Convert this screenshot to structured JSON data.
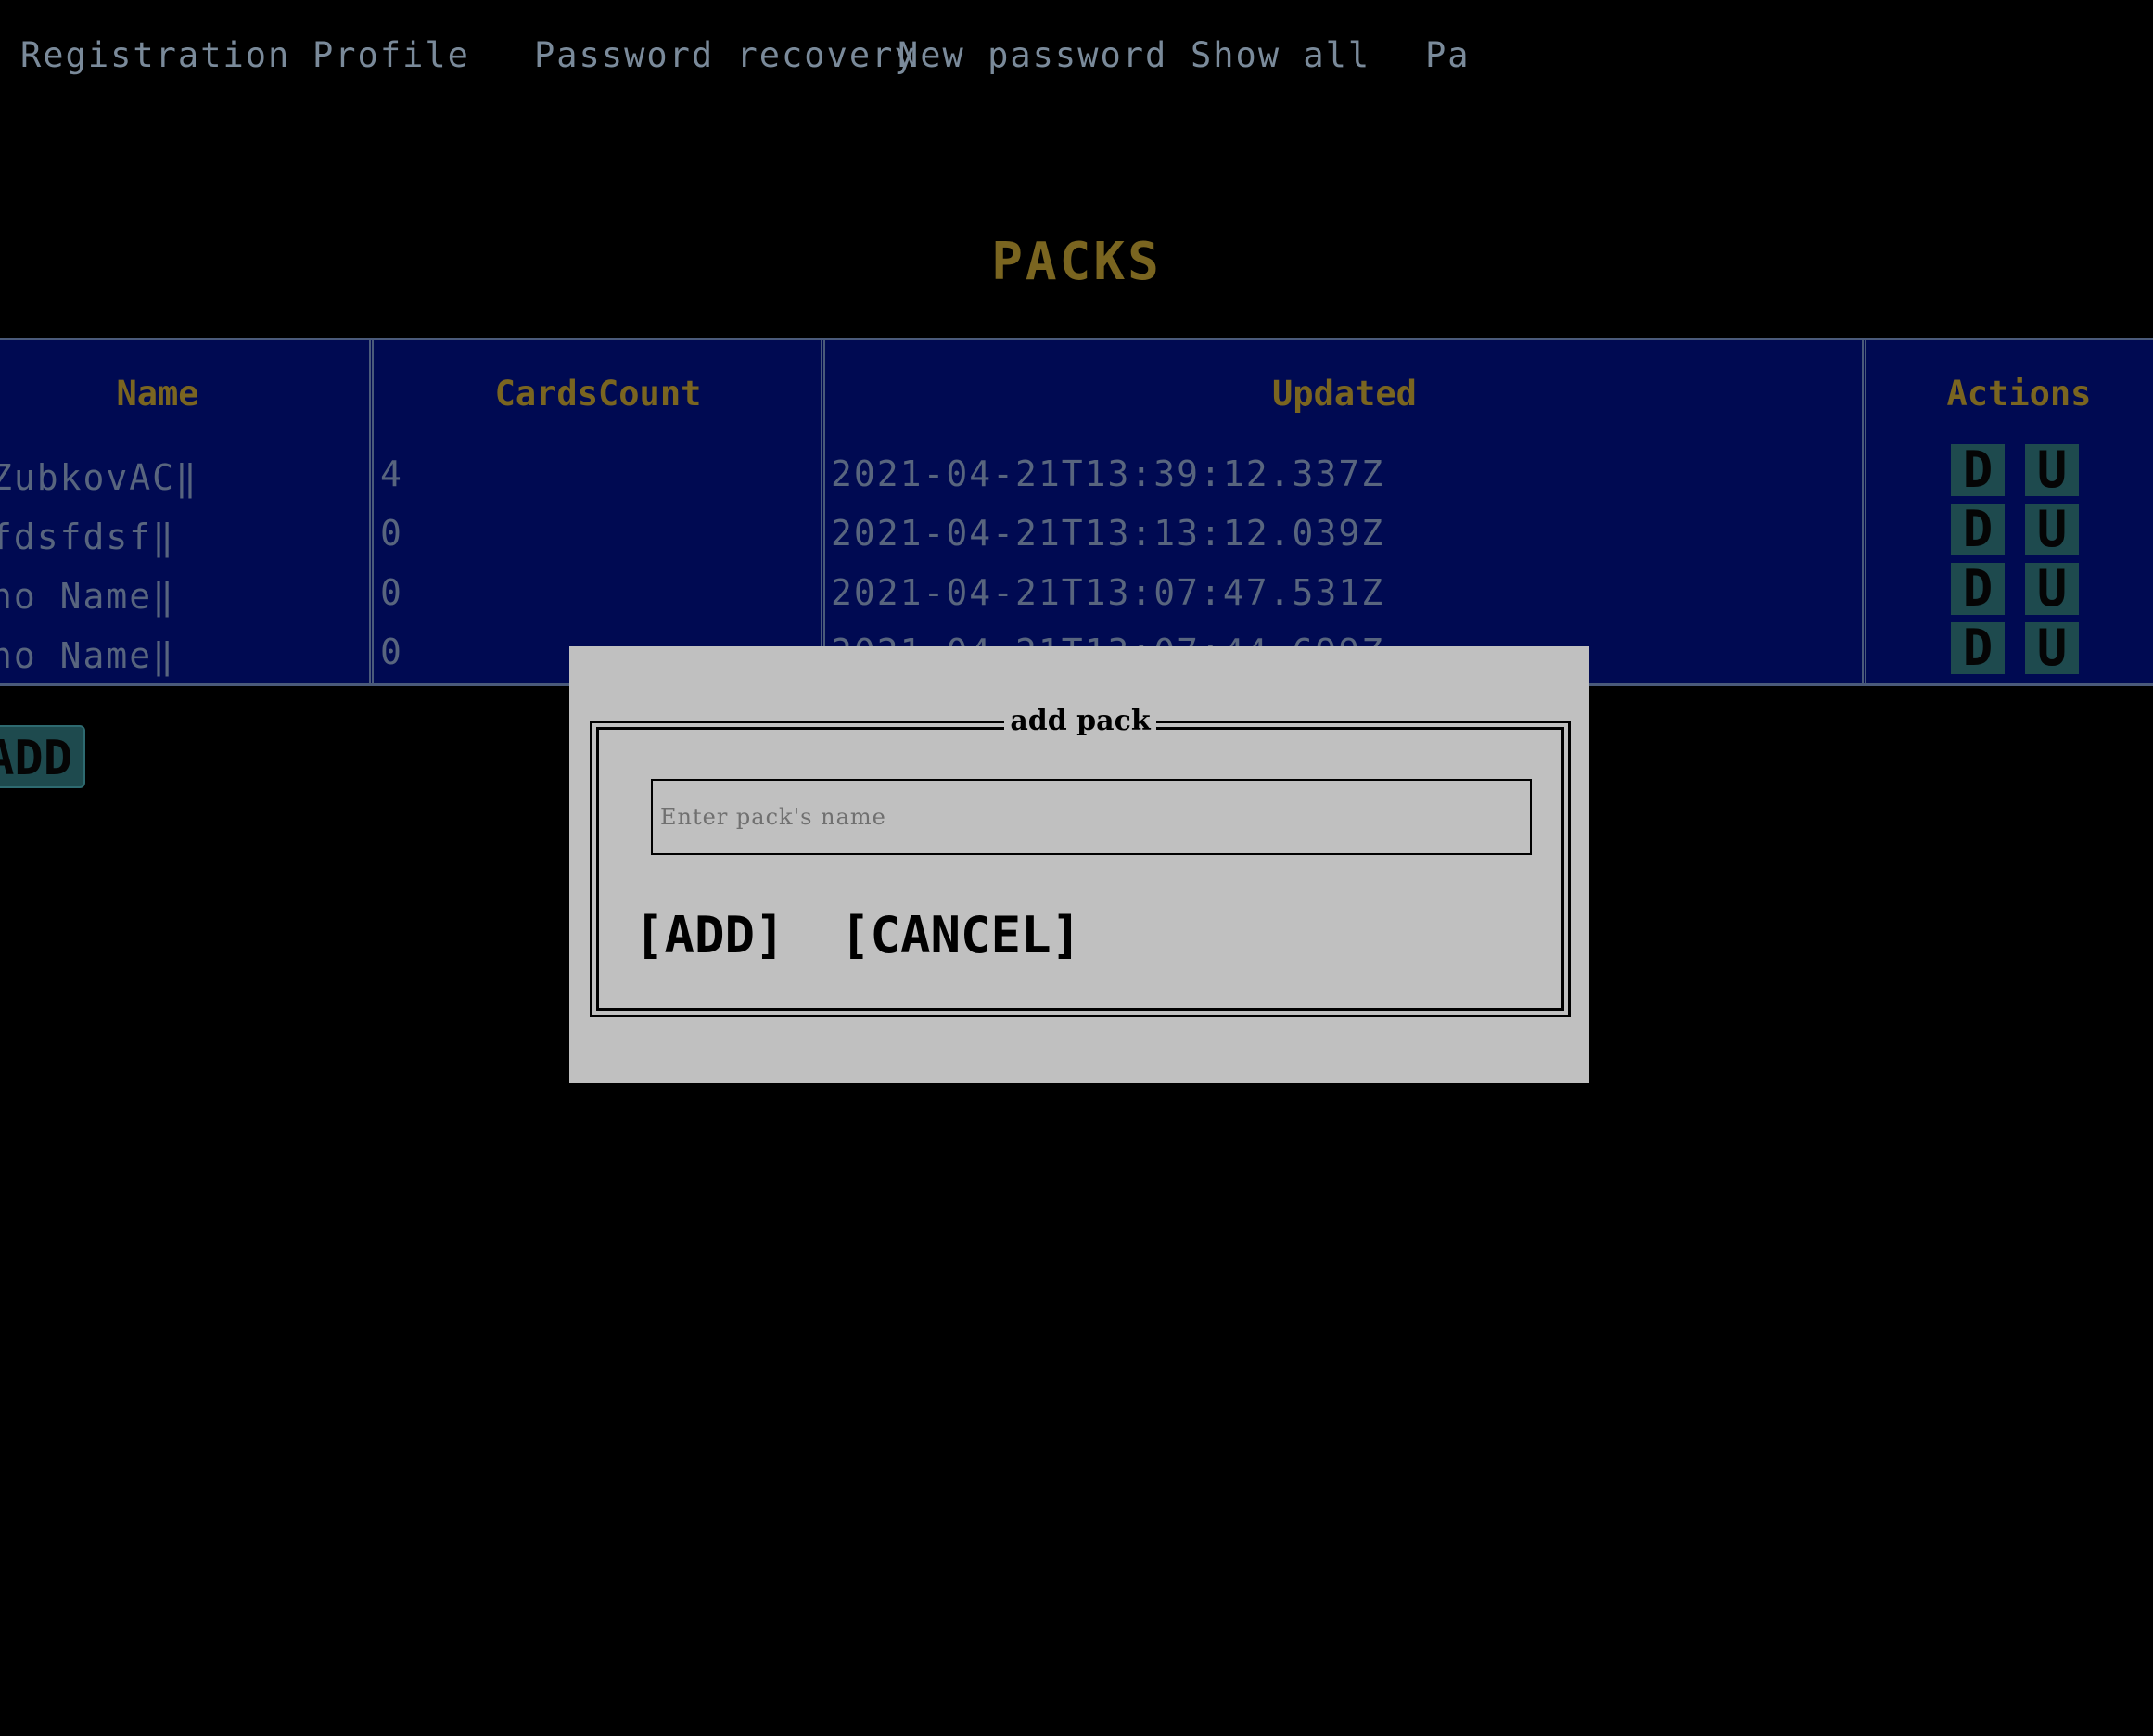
{
  "nav": {
    "items": [
      {
        "label": "Registration"
      },
      {
        "label": "Profile"
      },
      {
        "label": "Password recovery"
      },
      {
        "label": "New password"
      },
      {
        "label": "Show all"
      },
      {
        "label": "Pa"
      }
    ]
  },
  "title": "PACKS",
  "table": {
    "headers": {
      "name": "Name",
      "cards_count": "CardsCount",
      "updated": "Updated",
      "actions": "Actions"
    },
    "rows": [
      {
        "name": "ZubkovAC‖",
        "cards_count": "4",
        "updated": "2021-04-21T13:39:12.337Z"
      },
      {
        "name": "fdsfdsf‖",
        "cards_count": "0",
        "updated": "2021-04-21T13:13:12.039Z"
      },
      {
        "name": "no Name‖",
        "cards_count": "0",
        "updated": "2021-04-21T13:07:47.531Z"
      },
      {
        "name": "no Name‖",
        "cards_count": "0",
        "updated": "2021-04-21T13:07:44.699Z"
      }
    ],
    "action_labels": {
      "delete": "D",
      "update": "U"
    }
  },
  "page_add_label": "ADD",
  "modal": {
    "title": "add pack",
    "input_placeholder": "Enter pack's name",
    "input_value": "",
    "add_label": "[ADD]",
    "cancel_label": "[CANCEL]"
  },
  "colors": {
    "background": "#000000",
    "table_bg": "#000a52",
    "header_text": "#7a6520",
    "cell_text": "#58657e",
    "action_button_bg": "#1e4a4e",
    "modal_bg": "#c0c0c0"
  }
}
